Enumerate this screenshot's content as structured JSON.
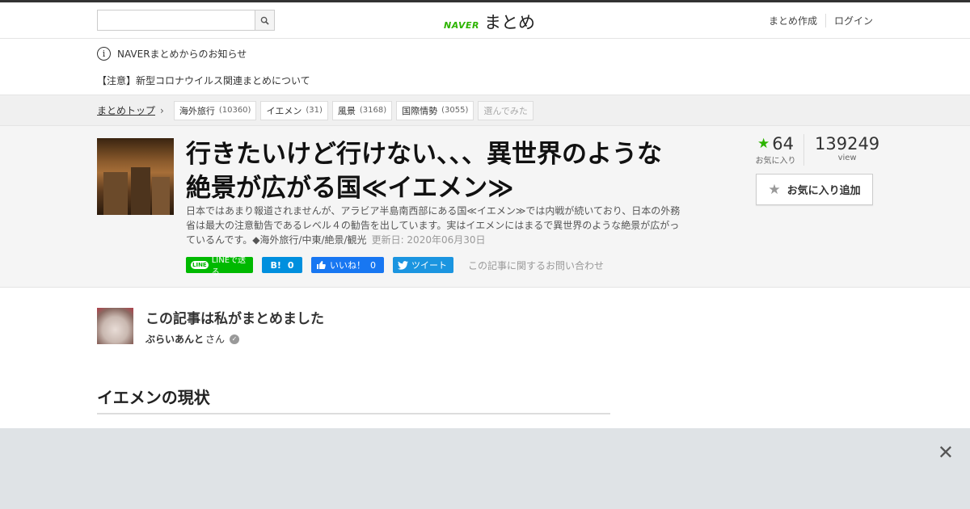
{
  "header": {
    "search_placeholder": "",
    "logo_brand": "NAVER",
    "logo_name": "まとめ",
    "create_link": "まとめ作成",
    "login_link": "ログイン"
  },
  "notice": {
    "title": "NAVERまとめからのお知らせ",
    "link": "【注意】新型コロナウイルス関連まとめについて"
  },
  "breadcrumb": {
    "top": "まとめトップ",
    "tags": [
      {
        "label": "海外旅行",
        "count": "(10360)"
      },
      {
        "label": "イエメン",
        "count": "(31)"
      },
      {
        "label": "風景",
        "count": "(3168)"
      },
      {
        "label": "国際情勢",
        "count": "(3055)"
      }
    ],
    "tried": "選んでみた"
  },
  "article": {
    "title": "行きたいけど行けない、、、異世界のような絶景が広がる国≪イエメン≫",
    "description": "日本ではあまり報道されませんが、アラビア半島南西部にある国≪イエメン≫では内戦が続いており、日本の外務省は最大の注意勧告であるレベル４の勧告を出しています。実はイエメンにはまるで異世界のような絶景が広がっているんです。◆海外旅行/中東/絶景/観光",
    "updated": "更新日: 2020年06月30日",
    "favorites_count": "64",
    "favorites_label": "お気に入り",
    "view_count": "139249",
    "view_label": "view",
    "fav_button": "お気に入り追加"
  },
  "share": {
    "line_badge": "LINE",
    "line_label": "LINEで送る",
    "hatena_label": "B!",
    "hatena_count": "0",
    "fb_label": "いいね！",
    "fb_count": "0",
    "tw_label": "ツイート",
    "inquiry": "この記事に関するお問い合わせ"
  },
  "author": {
    "title": "この記事は私がまとめました",
    "name": "ぶらいあんと",
    "suffix": "さん"
  },
  "section": {
    "heading": "イエメンの現状"
  },
  "ad": {
    "close": "✕"
  },
  "colors": {
    "brand_green": "#2db400",
    "line_green": "#00b900",
    "hatena_blue": "#008fde",
    "facebook_blue": "#1877f2",
    "twitter_blue": "#1b95e0"
  }
}
